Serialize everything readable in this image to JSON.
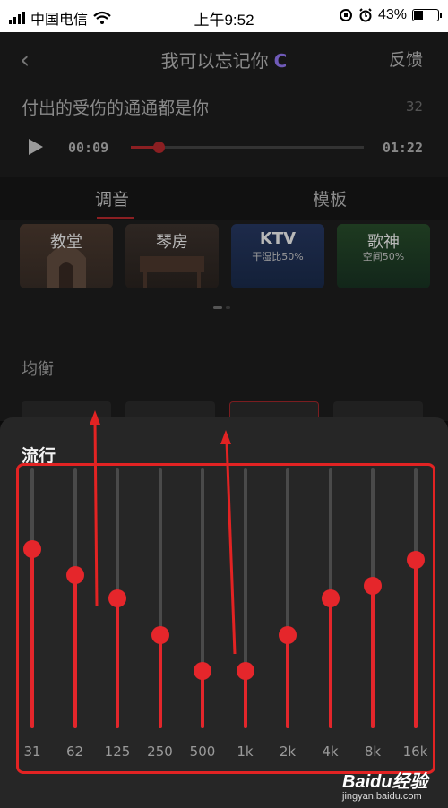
{
  "status_bar": {
    "carrier": "中国电信",
    "time": "上午9:52",
    "battery": "43%",
    "battery_level": 0.43
  },
  "header": {
    "back_icon": "chevron-left-icon",
    "title": "我可以忘记你",
    "title_badge": "C",
    "feedback_label": "反馈"
  },
  "lyric": {
    "text": "付出的受伤的通通都是你",
    "number": "32"
  },
  "player": {
    "current_time": "00:09",
    "total_time": "01:22",
    "progress": 0.12
  },
  "tabs": [
    {
      "label": "调音",
      "active": true
    },
    {
      "label": "模板",
      "active": false
    }
  ],
  "presets": [
    {
      "name": "教堂",
      "sub": ""
    },
    {
      "name": "琴房",
      "sub": ""
    },
    {
      "name": "KTV",
      "sub": "干湿比50%"
    },
    {
      "name": "歌神",
      "sub": "空间50%"
    }
  ],
  "equalizer": {
    "section_label": "均衡",
    "selected_preset": "流行"
  },
  "eq_bands": [
    {
      "freq": "31",
      "level": 0.69
    },
    {
      "freq": "62",
      "level": 0.59
    },
    {
      "freq": "125",
      "level": 0.5
    },
    {
      "freq": "250",
      "level": 0.36
    },
    {
      "freq": "500",
      "level": 0.22
    },
    {
      "freq": "1k",
      "level": 0.22
    },
    {
      "freq": "2k",
      "level": 0.36
    },
    {
      "freq": "4k",
      "level": 0.5
    },
    {
      "freq": "8k",
      "level": 0.55
    },
    {
      "freq": "16k",
      "level": 0.65
    }
  ],
  "watermark": {
    "brand": "Baidu经验",
    "url": "jingyan.baidu.com"
  },
  "colors": {
    "accent": "#e5262b",
    "rail": "#4a4a4a",
    "annotation": "#e22323"
  }
}
